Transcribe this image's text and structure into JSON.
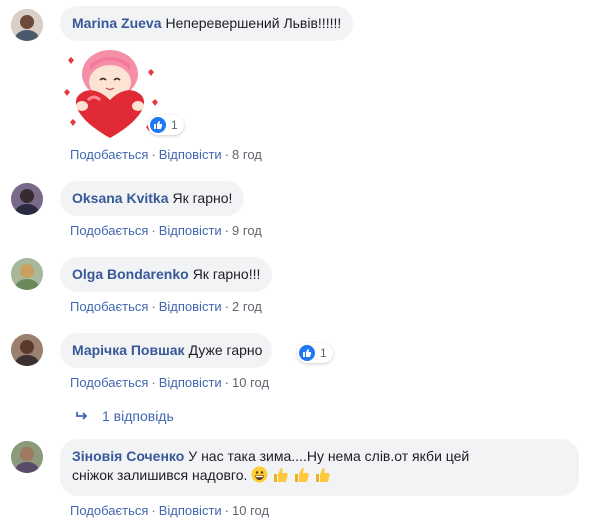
{
  "comments": [
    {
      "author": "Marina Zueva",
      "text": "Неперевершений Львів!!!!!!",
      "sticker": "girl-heart-sticker",
      "reaction_count": "1",
      "actions": {
        "like": "Подобається",
        "reply": "Відповісти",
        "time": "8 год"
      }
    },
    {
      "author": "Oksana Kvitka",
      "text": "Як гарно!",
      "actions": {
        "like": "Подобається",
        "reply": "Відповісти",
        "time": "9 год"
      }
    },
    {
      "author": "Olga Bondarenko",
      "text": "Як гарно!!!",
      "actions": {
        "like": "Подобається",
        "reply": "Відповісти",
        "time": "2 год"
      }
    },
    {
      "author": "Марічка Повшак",
      "text": "Дуже гарно",
      "reaction_count": "1",
      "actions": {
        "like": "Подобається",
        "reply": "Відповісти",
        "time": "10 год"
      },
      "replies_link": "1 відповідь"
    },
    {
      "author": "Зіновія Соченко",
      "text_line1": "У нас така зима....Ну нема слів.от якби цей",
      "text_line2": "сніжок залишився надовго.",
      "emojis": [
        "grinning-face",
        "thumbs-up",
        "thumbs-up",
        "thumbs-up"
      ],
      "actions": {
        "like": "Подобається",
        "reply": "Відповісти",
        "time": "10 год"
      }
    }
  ],
  "colors": {
    "author": "#385898",
    "action_link": "#4267b2",
    "bubble_bg": "#f2f3f5",
    "like_blue": "#2078f4"
  }
}
